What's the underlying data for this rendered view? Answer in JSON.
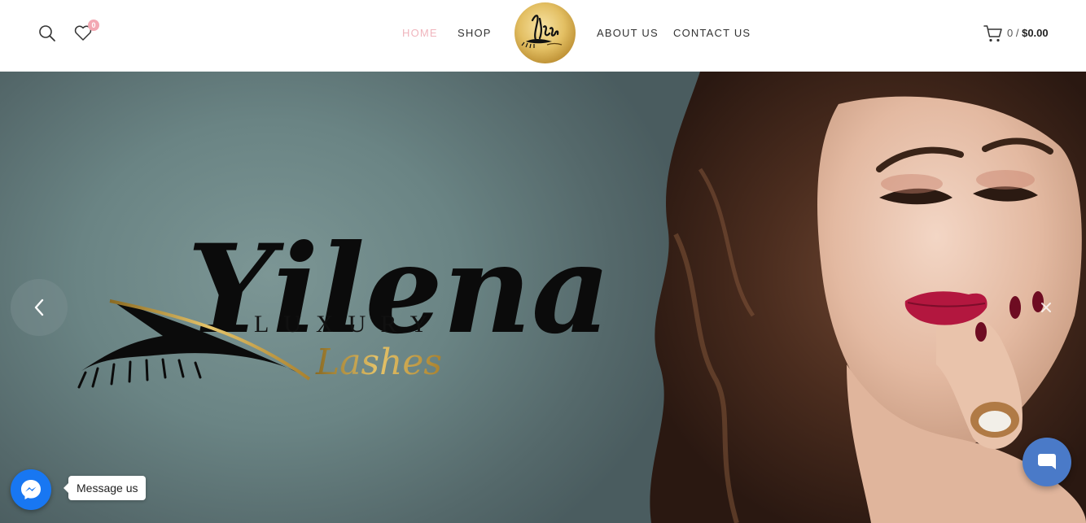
{
  "header": {
    "nav": [
      {
        "label": "HOME",
        "active": true
      },
      {
        "label": "SHOP",
        "active": false
      },
      {
        "label": "ABOUT US",
        "active": false
      },
      {
        "label": "CONTACT US",
        "active": false
      }
    ],
    "wishlist_count": "0",
    "cart_count": "0 /",
    "cart_total": "$0.00",
    "accent_color": "#f0b5bd"
  },
  "hero": {
    "brand_script": "Yilena",
    "brand_word": "LUXURY",
    "brand_tag": "Lashes"
  },
  "widgets": {
    "messenger_label": "Message us"
  },
  "icons": {
    "search": "search-icon",
    "wishlist": "heart-icon",
    "cart": "cart-icon",
    "prev": "chevron-left-icon",
    "next": "close-icon",
    "messenger": "messenger-icon",
    "chat": "chat-icon"
  }
}
